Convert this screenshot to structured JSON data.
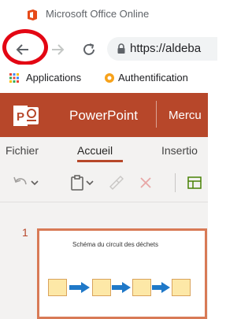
{
  "browser": {
    "tab_title": "Microsoft Office Online",
    "url": "https://aldeba",
    "bookmarks": [
      {
        "label": "Applications"
      },
      {
        "label": "Authentification"
      }
    ]
  },
  "app": {
    "name": "PowerPoint",
    "document_name": "Mercu"
  },
  "ribbon": {
    "tabs": [
      {
        "label": "Fichier"
      },
      {
        "label": "Accueil",
        "active": true
      },
      {
        "label": "Insertio"
      }
    ]
  },
  "slides": [
    {
      "number": "1",
      "title": "Schéma du circuit des déchets",
      "box_count": 4
    }
  ],
  "colors": {
    "ppt_brand": "#b7472a",
    "highlight_circle": "#e30613",
    "arrow": "#1f78c8",
    "slide_box_fill": "#fde8a7",
    "slide_border": "#d87a56"
  },
  "icons": [
    "office-icon",
    "back-arrow-icon",
    "forward-arrow-icon",
    "reload-icon",
    "lock-icon",
    "apps-grid-icon",
    "auth-icon",
    "powerpoint-logo-icon",
    "undo-icon",
    "clipboard-icon",
    "format-painter-icon",
    "delete-icon",
    "layout-icon"
  ]
}
